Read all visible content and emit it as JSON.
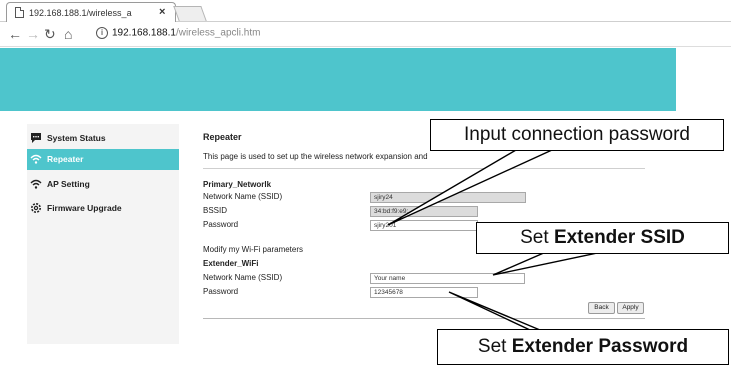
{
  "colors": {
    "accent": "#4ec5cc",
    "sidebar_bg": "#f4f4f4",
    "readonly_bg": "#dcdcdc"
  },
  "browser": {
    "tab_title": "192.168.188.1/wireless_a",
    "tab_close": "×",
    "url_host": "192.168.188.1",
    "url_path": "/wireless_apcli.htm"
  },
  "sidebar": {
    "items": [
      {
        "label": "System Status",
        "icon": "chat-icon"
      },
      {
        "label": "Repeater",
        "icon": "wifi-icon",
        "active": true
      },
      {
        "label": "AP Setting",
        "icon": "wifi-icon"
      },
      {
        "label": "Firmware Upgrade",
        "icon": "gear-icon"
      }
    ]
  },
  "main": {
    "title": "Repeater",
    "description": "This page is used to set up the wireless network expansion and",
    "primary": {
      "heading": "Primary_Networlk",
      "ssid_label": "Network Name (SSID)",
      "ssid_value": "sjiry24",
      "bssid_label": "BSSID",
      "bssid_value": "34:bd:f9:e9:",
      "password_label": "Password",
      "password_value": "sjiry201"
    },
    "modify_label": "Modify my Wi-Fi parameters",
    "extender": {
      "heading": "Extender_WiFi",
      "ssid_label": "Network Name (SSID)",
      "ssid_value": "Your name",
      "password_label": "Password",
      "password_value": "12345678"
    },
    "buttons": {
      "back": "Back",
      "apply": "Apply"
    }
  },
  "callouts": {
    "input_password": "Input connection password",
    "set_ssid_prefix": "Set ",
    "set_ssid_bold": "Extender SSID",
    "set_password_prefix": "Set ",
    "set_password_bold": "Extender Password"
  }
}
